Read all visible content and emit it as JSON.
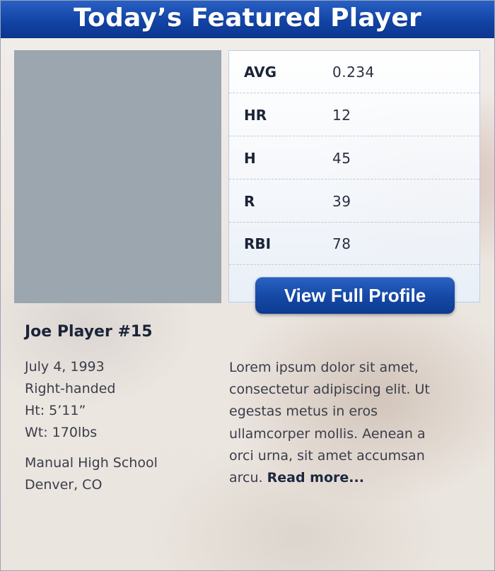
{
  "header": {
    "title": "Today’s Featured Player"
  },
  "stats": [
    {
      "label": "AVG",
      "value": "0.234"
    },
    {
      "label": "HR",
      "value": "12"
    },
    {
      "label": "H",
      "value": "45"
    },
    {
      "label": "R",
      "value": "39"
    },
    {
      "label": "RBI",
      "value": "78"
    }
  ],
  "profile_button": {
    "label": "View Full Profile"
  },
  "player": {
    "name": "Joe Player #15",
    "birthdate": "July 4, 1993",
    "handedness": "Right-handed",
    "height": "Ht: 5’11”",
    "weight": "Wt: 170lbs",
    "school": "Manual High School",
    "location": "Denver, CO"
  },
  "bio": {
    "lines": [
      "Lorem ipsum dolor sit amet,",
      "consectetur adipiscing elit. Ut",
      "egestas metus in eros",
      "ullamcorper mollis. Aenean a",
      "orci urna, sit amet accumsan",
      "arcu."
    ],
    "read_more": "Read more..."
  }
}
